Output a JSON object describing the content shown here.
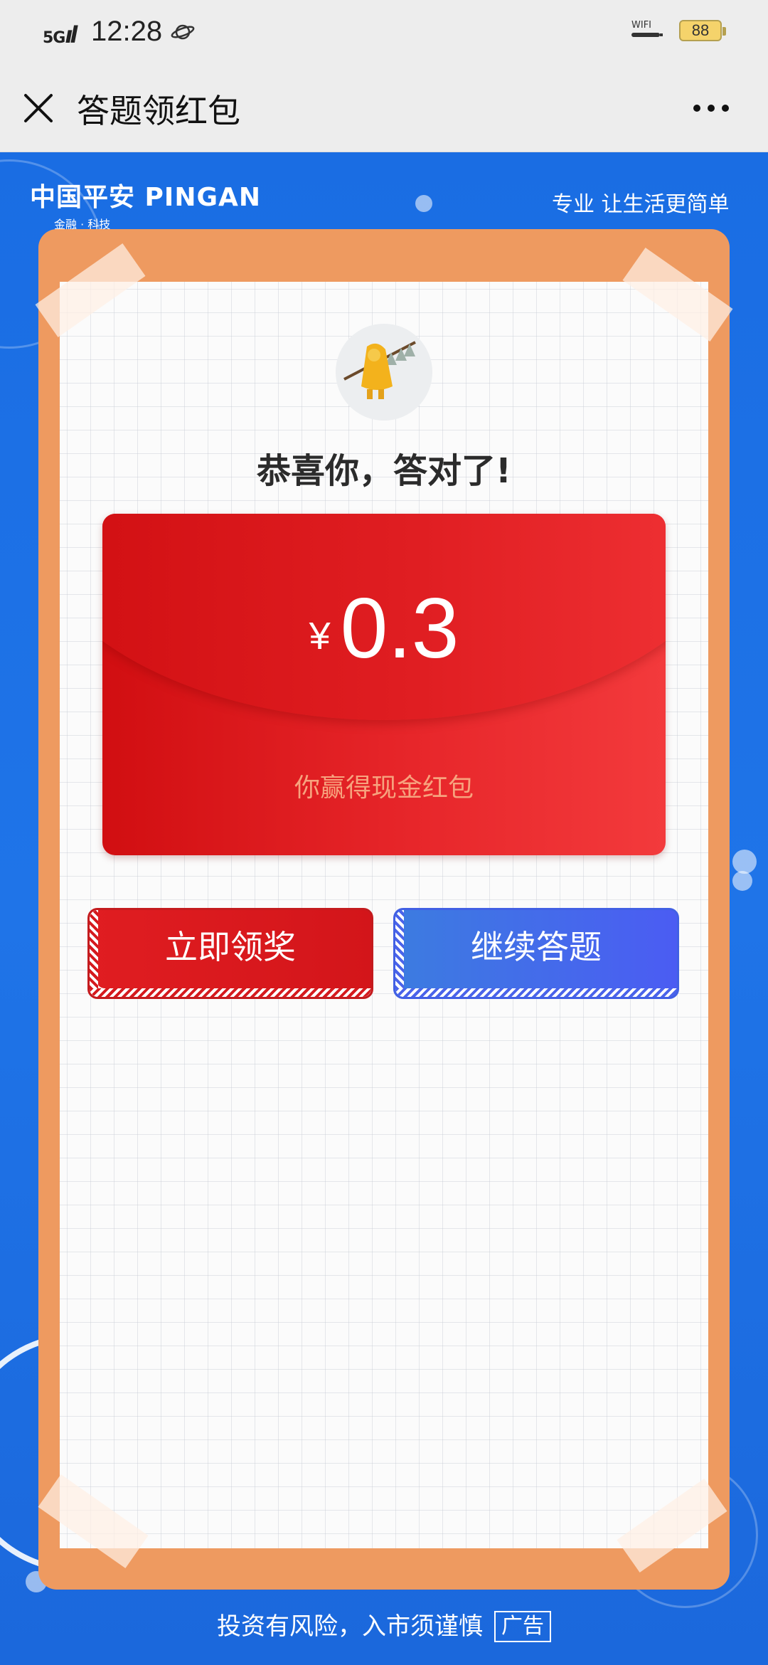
{
  "status_bar": {
    "network": "5G",
    "time": "12:28",
    "wifi_label": "WIFI",
    "battery": "88",
    "icons": [
      "signal-icon",
      "planet-icon",
      "wifi-icon",
      "battery-icon"
    ]
  },
  "title_bar": {
    "title": "答题领红包",
    "close_icon": "close-icon",
    "more_icon": "more-icon"
  },
  "brand": {
    "name": "中国平安 PINGAN",
    "sub": "金融 · 科技",
    "slogan": "专业 让生活更简单"
  },
  "result": {
    "message": "恭喜你，答对了!",
    "currency": "¥",
    "amount": "0.3",
    "caption": "你赢得现金红包"
  },
  "buttons": {
    "claim": "立即领奖",
    "continue": "继续答题"
  },
  "footer": {
    "disclaimer": "投资有风险，入市须谨慎",
    "ad_label": "广告"
  },
  "colors": {
    "background_blue": "#1b6fe0",
    "frame_orange": "#ee9a60",
    "envelope_red": "#e01e22",
    "claim_red": "#e01d21",
    "continue_blue": "#4b5cf3",
    "caption_orange": "#f7a37e"
  }
}
